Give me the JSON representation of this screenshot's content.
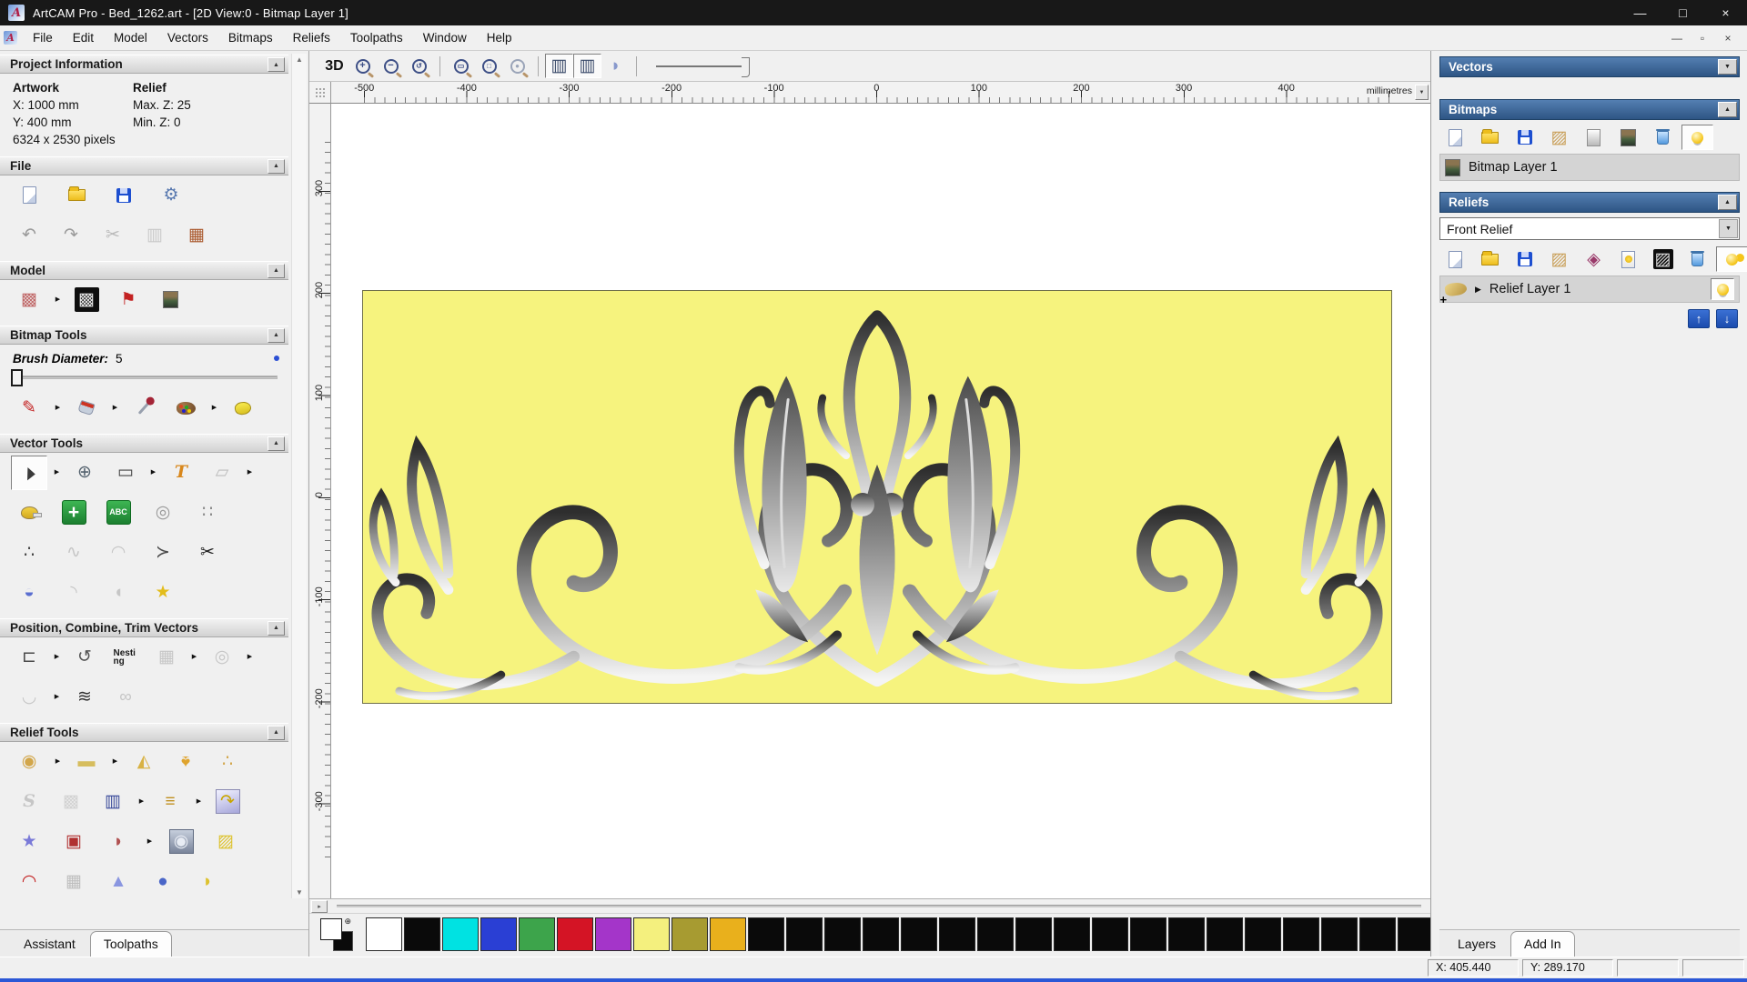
{
  "window": {
    "title": "ArtCAM Pro - Bed_1262.art - [2D View:0 - Bitmap Layer 1]",
    "controls": {
      "minimize": "—",
      "maximize": "□",
      "close": "×"
    },
    "mdi": {
      "minimize": "—",
      "restore": "▫",
      "close": "×"
    },
    "logo_letter": "A"
  },
  "menu": {
    "items": [
      {
        "name": "menu-file",
        "label": "File"
      },
      {
        "name": "menu-edit",
        "label": "Edit"
      },
      {
        "name": "menu-model",
        "label": "Model"
      },
      {
        "name": "menu-vectors",
        "label": "Vectors"
      },
      {
        "name": "menu-bitmaps",
        "label": "Bitmaps"
      },
      {
        "name": "menu-reliefs",
        "label": "Reliefs"
      },
      {
        "name": "menu-toolpaths",
        "label": "Toolpaths"
      },
      {
        "name": "menu-window",
        "label": "Window"
      },
      {
        "name": "menu-help",
        "label": "Help"
      }
    ]
  },
  "assistant": {
    "project": {
      "header": "Project Information",
      "artwork_label": "Artwork",
      "relief_label": "Relief",
      "artwork_x": "X: 1000 mm",
      "artwork_y": "Y: 400 mm",
      "artwork_pixels": "6324 x 2530 pixels",
      "relief_max": "Max. Z: 25",
      "relief_min": "Min. Z: 0"
    },
    "file": {
      "header": "File",
      "row1": [
        {
          "name": "new-model-icon",
          "icls": "i-page"
        },
        {
          "name": "open-model-icon",
          "icls": "i-folder"
        },
        {
          "name": "save-model-icon",
          "icls": "i-floppy"
        },
        {
          "name": "options-icon",
          "glyph": "⚙",
          "color": "#5a7ab0"
        }
      ],
      "row2": [
        {
          "name": "undo-icon",
          "glyph": "↶",
          "color": "#9b9b9b"
        },
        {
          "name": "redo-icon",
          "glyph": "↷",
          "color": "#9b9b9b"
        },
        {
          "name": "cut-icon",
          "glyph": "✂",
          "color": "#b9b9b9"
        },
        {
          "name": "copy-icon",
          "glyph": "▥",
          "color": "#c9c9c9"
        },
        {
          "name": "paste-icon",
          "glyph": "▦",
          "color": "#a9572b"
        }
      ]
    },
    "model": {
      "header": "Model",
      "row1": [
        {
          "name": "set-model-size-icon",
          "glyph": "▩",
          "color": "#c06868"
        },
        {
          "name": "flyout-arrow-icon",
          "glyph": "▶",
          "state": "fly"
        },
        {
          "name": "greyscale-preview-icon",
          "glyph": "▩",
          "color": "#e6e6e6",
          "icls": "bx-black"
        },
        {
          "name": "lighting-icon",
          "glyph": "⚑",
          "color": "#c32222"
        },
        {
          "name": "load-image-icon",
          "icls": "i-img"
        }
      ]
    },
    "bitmap_tools": {
      "header": "Bitmap Tools",
      "brush_label": "Brush Diameter:",
      "brush_value": "5",
      "row1": [
        {
          "name": "paint-icon",
          "glyph": "✎",
          "color": "#c32222"
        },
        {
          "name": "flyout-arrow-icon",
          "glyph": "▶",
          "state": "fly"
        },
        {
          "name": "flood-fill-icon",
          "icls": "i-bucket"
        },
        {
          "name": "flyout-arrow-icon",
          "glyph": "▶",
          "state": "fly"
        },
        {
          "name": "colour-picker-icon",
          "icls": "i-dropper"
        },
        {
          "name": "palette-icon",
          "icls": "i-palette"
        },
        {
          "name": "flyout-arrow-icon",
          "glyph": "▶",
          "state": "fly"
        },
        {
          "name": "texture-sponge-icon",
          "icls": "i-sponge"
        }
      ]
    },
    "vector_tools": {
      "header": "Vector Tools",
      "row1": [
        {
          "name": "select-vectors-icon",
          "glyph": "▲",
          "icls": "cursor",
          "color": "#3a3a3a",
          "state": "pressed"
        },
        {
          "name": "flyout-arrow-icon",
          "glyph": "▶",
          "state": "fly"
        },
        {
          "name": "transform-vectors-icon",
          "glyph": "⊕",
          "color": "#55636f"
        },
        {
          "name": "create-rectangle-icon",
          "glyph": "▭",
          "color": "#444444"
        },
        {
          "name": "flyout-arrow-icon",
          "glyph": "▶",
          "state": "fly"
        },
        {
          "name": "create-text-icon",
          "glyph": "T",
          "color": "#d8871c",
          "icls": "ser"
        },
        {
          "name": "envelope-distort-icon",
          "glyph": "▱",
          "color": "#bdbdbd"
        },
        {
          "name": "flyout-arrow-icon",
          "glyph": "▶",
          "state": "fly"
        }
      ],
      "row2": [
        {
          "name": "measure-icon",
          "icls": "i-tape"
        },
        {
          "name": "snap-grid-icon",
          "glyph": "+",
          "icls": "bx-green big"
        },
        {
          "name": "text-block-icon",
          "glyph": "ABC",
          "icls": "bx-green tny"
        },
        {
          "name": "wrap-text-icon",
          "glyph": "◎",
          "color": "#9a9a9a"
        },
        {
          "name": "block-paste-icon",
          "glyph": "∷",
          "color": "#8a8a8a"
        }
      ],
      "row3": [
        {
          "name": "node-editing-icon",
          "glyph": "∴",
          "color": "#444444"
        },
        {
          "name": "fit-vectors-icon",
          "glyph": "∿",
          "color": "#c6c6c6"
        },
        {
          "name": "arc-fit-icon",
          "glyph": "◠",
          "color": "#c6c6c6"
        },
        {
          "name": "create-polyline-icon",
          "glyph": "≻",
          "color": "#4a4a4a"
        },
        {
          "name": "trim-vectors-icon",
          "glyph": "✂",
          "color": "#1c1c1c"
        }
      ],
      "row4": [
        {
          "name": "spin-profile-icon",
          "glyph": "◒",
          "color": "#5a6ed0"
        },
        {
          "name": "freehand-curve-icon",
          "glyph": "◝",
          "color": "#c6c6c6"
        },
        {
          "name": "mirror-vectors-icon",
          "glyph": "◖",
          "color": "#c6c6c6"
        },
        {
          "name": "create-star-icon",
          "glyph": "★",
          "color": "#e3bd1c"
        }
      ]
    },
    "position_tools": {
      "header": "Position, Combine, Trim Vectors",
      "row1": [
        {
          "name": "align-vectors-icon",
          "glyph": "⊏",
          "color": "#4a4a4a"
        },
        {
          "name": "flyout-arrow-icon",
          "glyph": "▶",
          "state": "fly"
        },
        {
          "name": "text-on-curve-icon",
          "glyph": "↺",
          "color": "#555555"
        },
        {
          "name": "nesting-icon",
          "glyph": "Nesting",
          "icls": "wrap2"
        },
        {
          "name": "group-vectors-icon",
          "glyph": "▦",
          "color": "#c6c6c6"
        },
        {
          "name": "flyout-arrow-icon",
          "glyph": "▶",
          "state": "fly"
        },
        {
          "name": "weld-vectors-icon",
          "glyph": "◎",
          "color": "#c6c6c6"
        },
        {
          "name": "flyout-arrow-icon",
          "glyph": "▶",
          "state": "fly"
        }
      ],
      "row2": [
        {
          "name": "join-vectors-icon",
          "glyph": "◡",
          "color": "#c6c6c6"
        },
        {
          "name": "flyout-arrow-icon",
          "glyph": "▶",
          "state": "fly"
        },
        {
          "name": "vector-texture-icon",
          "glyph": "≋",
          "color": "#333333"
        },
        {
          "name": "interlock-vectors-icon",
          "glyph": "∞",
          "color": "#c6c6c6"
        }
      ]
    },
    "relief_tools": {
      "header": "Relief Tools",
      "row1": [
        {
          "name": "calculate-relief-icon",
          "glyph": "◉",
          "color": "#d2a64a"
        },
        {
          "name": "flyout-arrow-icon",
          "glyph": "▶",
          "state": "fly"
        },
        {
          "name": "zero-plane-icon",
          "glyph": "▬",
          "color": "#d6bd5e"
        },
        {
          "name": "flyout-arrow-icon",
          "glyph": "▶",
          "state": "fly"
        },
        {
          "name": "smooth-relief-icon",
          "glyph": "◭",
          "color": "#d8b243"
        },
        {
          "name": "dome-relief-icon",
          "glyph": "♠",
          "color": "#dfa42e",
          "icls": "rot180"
        },
        {
          "name": "sculpt-relief-icon",
          "glyph": "∴",
          "color": "#d2a64a"
        }
      ],
      "row2": [
        {
          "name": "smooth-s-icon",
          "glyph": "S",
          "color": "#c6c6c6",
          "icls": "ser"
        },
        {
          "name": "weave-relief-icon",
          "glyph": "▩",
          "color": "#d2d2d2"
        },
        {
          "name": "relief-clipart-icon",
          "glyph": "▥",
          "color": "#3a4a9a"
        },
        {
          "name": "flyout-arrow-icon",
          "glyph": "▶",
          "state": "fly"
        },
        {
          "name": "relief-layer-stack-icon",
          "glyph": "≡",
          "color": "#c09020"
        },
        {
          "name": "flyout-arrow-icon",
          "glyph": "▶",
          "state": "fly"
        },
        {
          "name": "copy-relief-icon",
          "glyph": "↷",
          "color": "#c8a500",
          "icls": "bx-lav"
        }
      ],
      "row3": [
        {
          "name": "star-relief-icon",
          "glyph": "★",
          "color": "#7a7ad8"
        },
        {
          "name": "wrap-relief-icon",
          "glyph": "▣",
          "color": "#b03030"
        },
        {
          "name": "fan-relief-icon",
          "glyph": "◗",
          "color": "#b05050"
        },
        {
          "name": "flyout-arrow-icon",
          "glyph": "▶",
          "state": "fly"
        },
        {
          "name": "emboss-relief-icon",
          "glyph": "◉",
          "color": "#e8ecf4",
          "icls": "bx-sil"
        },
        {
          "name": "offset-relief-icon",
          "glyph": "▨",
          "color": "#ddc22e"
        }
      ],
      "row4": [
        {
          "name": "texture-relief-icon",
          "glyph": "◠",
          "color": "#c32222"
        },
        {
          "name": "mesh-relief-icon",
          "glyph": "▦",
          "color": "#bdbdbd"
        },
        {
          "name": "pyramid-relief-icon",
          "glyph": "▲",
          "color": "#8a96e0"
        },
        {
          "name": "sphere-relief-icon",
          "glyph": "●",
          "color": "#4a66c8"
        },
        {
          "name": "two-rail-sweep-icon",
          "glyph": "◗",
          "color": "#ddc22e"
        }
      ]
    },
    "tabs": [
      {
        "label": "Assistant"
      },
      {
        "label": "Toolpaths"
      }
    ]
  },
  "canvas": {
    "toolbar_g1": [
      {
        "name": "view-3d-button",
        "glyph": "3D",
        "icls": "b3d"
      },
      {
        "name": "zoom-in-icon",
        "glyph": "+",
        "icls": "i-mag"
      },
      {
        "name": "zoom-out-icon",
        "glyph": "−",
        "icls": "i-mag"
      },
      {
        "name": "zoom-previous-icon",
        "glyph": "↺",
        "icls": "i-mag sm"
      }
    ],
    "toolbar_g2": [
      {
        "name": "zoom-window-icon",
        "glyph": "▭",
        "icls": "i-mag sm"
      },
      {
        "name": "zoom-fit-icon",
        "glyph": "□",
        "icls": "i-mag sm"
      },
      {
        "name": "zoom-objects-icon",
        "glyph": "●",
        "icls": "i-mag sm dim"
      }
    ],
    "toolbar_g3": [
      {
        "name": "toggle-bitmap-view-icon",
        "glyph": "▥",
        "color": "#3a4a6a",
        "state": "pressed"
      },
      {
        "name": "toggle-vector-view-icon",
        "glyph": "▥",
        "color": "#3a4a6a",
        "state": "pressed"
      },
      {
        "name": "preview-relief-icon",
        "glyph": "◗",
        "color": "#8899cc"
      }
    ],
    "ruler_top": {
      "labels": [
        "-500",
        "-400",
        "-300",
        "-200",
        "-100",
        "0",
        "100",
        "200",
        "300",
        "400"
      ],
      "unit": "millimetres"
    },
    "ruler_left": {
      "labels": [
        "300",
        "200",
        "100",
        "0",
        "-100",
        "-200",
        "-300"
      ]
    },
    "artwork_bg": "#f6f37e"
  },
  "palette": {
    "swatches": [
      "#ffffff",
      "#0a0a0a",
      "#00e2e2",
      "#2a3fd4",
      "#3da44b",
      "#d41425",
      "#a435c9",
      "#f4f07e",
      "#a79b31",
      "#e9b01c",
      "#0a0a0a",
      "#0a0a0a",
      "#0a0a0a",
      "#0a0a0a",
      "#0a0a0a",
      "#0a0a0a",
      "#0a0a0a",
      "#0a0a0a",
      "#0a0a0a",
      "#0a0a0a",
      "#0a0a0a",
      "#0a0a0a",
      "#0a0a0a",
      "#0a0a0a",
      "#0a0a0a",
      "#0a0a0a",
      "#0a0a0a",
      "#0a0a0a"
    ]
  },
  "right_panel": {
    "vectors": {
      "header": "Vectors"
    },
    "bitmaps": {
      "header": "Bitmaps",
      "layer_label": "Bitmap Layer 1",
      "tools": [
        {
          "name": "new-bitmap-icon",
          "icls": "i-page"
        },
        {
          "name": "open-bitmap-icon",
          "icls": "i-folder"
        },
        {
          "name": "save-bitmap-icon",
          "icls": "i-floppy"
        },
        {
          "name": "import-bitmap-icon",
          "glyph": "▨",
          "color": "#c9a05a"
        },
        {
          "name": "blank-bitmap-icon",
          "icls": "i-pageg"
        },
        {
          "name": "bitmap-to-layer-icon",
          "icls": "i-img"
        },
        {
          "name": "delete-bitmap-icon",
          "icls": "i-trash"
        },
        {
          "name": "bitmap-visibility-icon",
          "icls": "i-bulb",
          "state": "pressed"
        }
      ]
    },
    "reliefs": {
      "header": "Reliefs",
      "dropdown_value": "Front Relief",
      "layer_label": "Relief Layer 1",
      "tools": [
        {
          "name": "new-relief-icon",
          "icls": "i-page"
        },
        {
          "name": "open-relief-icon",
          "icls": "i-folder"
        },
        {
          "name": "save-relief-icon",
          "icls": "i-floppy"
        },
        {
          "name": "import-relief-icon",
          "glyph": "▨",
          "color": "#c9a05a"
        },
        {
          "name": "transfer-relief-icon",
          "glyph": "◈",
          "color": "#9a3a6a"
        },
        {
          "name": "relief-preview-icon",
          "icls": "i-bulbpg"
        },
        {
          "name": "greyscale-from-relief-icon",
          "glyph": "▨",
          "icls": "bx-black sm2",
          "color": "#dddddd"
        },
        {
          "name": "delete-relief-icon",
          "icls": "i-trash"
        },
        {
          "name": "relief-visibility-icon",
          "icls": "i-bulb2",
          "state": "pressed"
        }
      ]
    },
    "tabs": [
      {
        "label": "Layers"
      },
      {
        "label": "Add In"
      }
    ]
  },
  "status": {
    "x": "X: 405.440",
    "y": "Y: 289.170"
  }
}
